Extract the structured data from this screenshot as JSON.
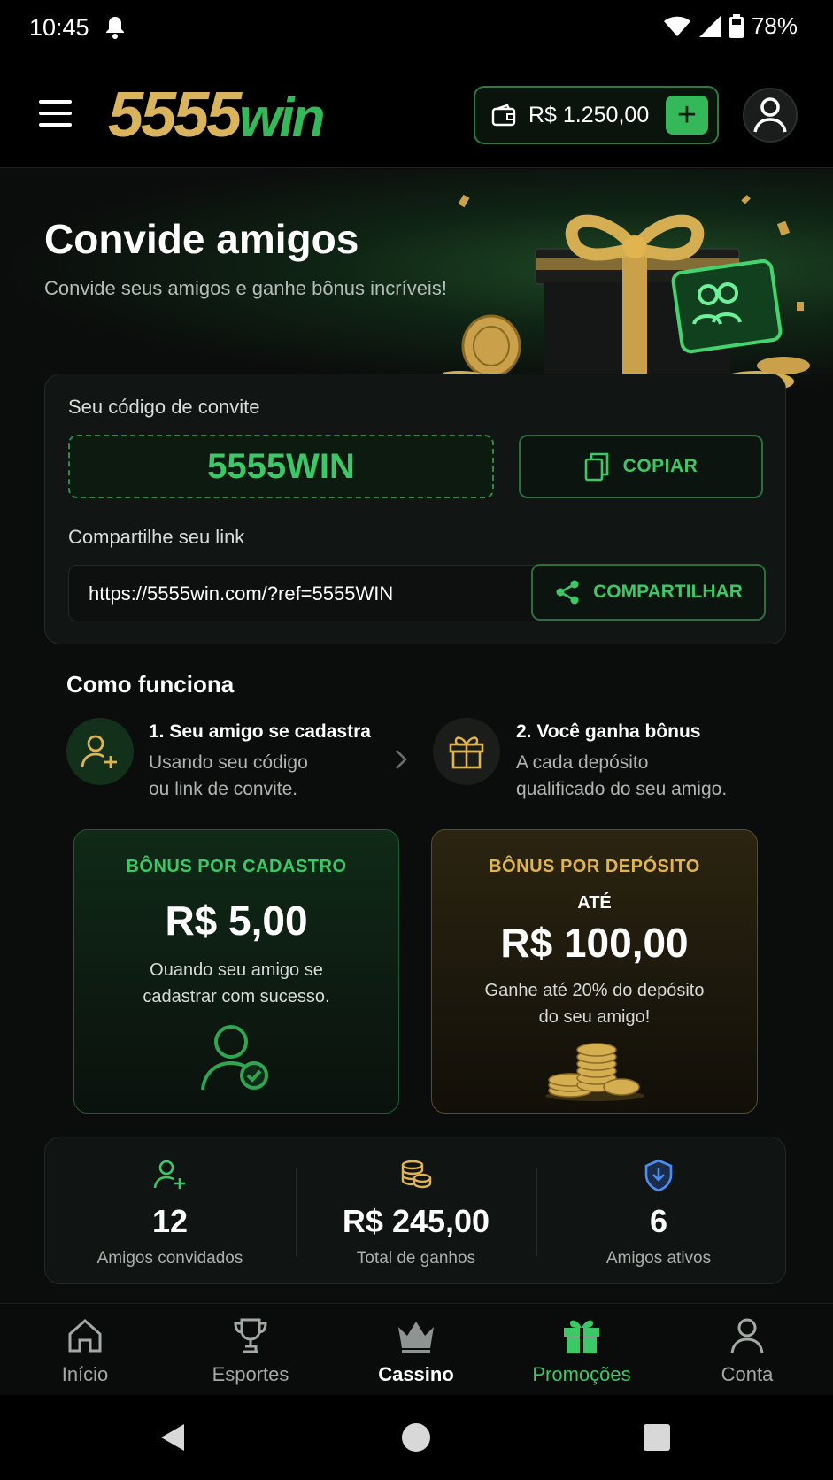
{
  "status_bar": {
    "time": "10:45",
    "battery": "78%"
  },
  "header": {
    "logo_num": "5555",
    "logo_win": "win",
    "balance": "R$ 1.250,00",
    "add_label": "+"
  },
  "hero": {
    "title": "Convide amigos",
    "subtitle": "Convide seus amigos e ganhe bônus incríveis!"
  },
  "invite": {
    "code_label": "Seu código de convite",
    "code": "5555WIN",
    "copy_label": "COPIAR",
    "link_label": "Compartilhe seu link",
    "link": "https://5555win.com/?ref=5555WIN",
    "share_label": "COMPARTILHAR"
  },
  "how": {
    "title": "Como funciona",
    "steps": [
      {
        "title": "1. Seu amigo se cadastra",
        "desc1": "Usando seu código",
        "desc2": "ou link de convite."
      },
      {
        "title": "2. Você ganha bônus",
        "desc1": "A cada depósito",
        "desc2": "qualificado do seu amigo."
      }
    ]
  },
  "bonus": {
    "signup": {
      "title": "BÔNUS POR CADASTRO",
      "amount": "R$ 5,00",
      "desc1": "Ouando seu amigo se",
      "desc2": "cadastrar com sucesso."
    },
    "deposit": {
      "title": "BÔNUS POR DEPÓSITO",
      "prefix": "ATÉ",
      "amount": "R$ 100,00",
      "desc1": "Ganhe até 20% do depósito",
      "desc2": "do seu amigo!"
    }
  },
  "stats": [
    {
      "value": "12",
      "label": "Amigos convidados",
      "icon": "user-plus-icon"
    },
    {
      "value": "R$ 245,00",
      "label": "Total de ganhos",
      "icon": "coins-icon"
    },
    {
      "value": "6",
      "label": "Amigos ativos",
      "icon": "shield-icon"
    }
  ],
  "nav": [
    {
      "label": "Início",
      "icon": "home-icon"
    },
    {
      "label": "Esportes",
      "icon": "trophy-icon"
    },
    {
      "label": "Cassino",
      "icon": "crown-icon"
    },
    {
      "label": "Promoções",
      "icon": "gift-icon"
    },
    {
      "label": "Conta",
      "icon": "user-icon"
    }
  ],
  "colors": {
    "accent_green": "#3cc866",
    "accent_gold": "#e0b550",
    "background": "#0b0d0c"
  }
}
